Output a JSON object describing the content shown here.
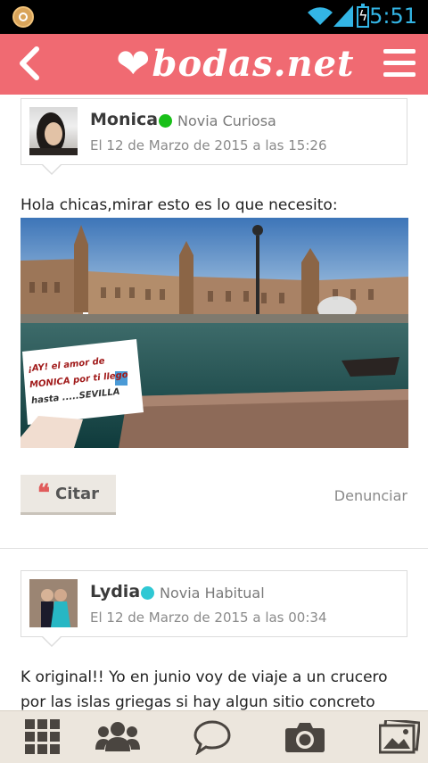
{
  "status_bar": {
    "time": "5:51"
  },
  "app_bar": {
    "brand": "bodas.net"
  },
  "posts": [
    {
      "author": "Monica",
      "online_color": "#19c019",
      "role": "Novia Curiosa",
      "date": "El 12 de Marzo de 2015 a las 15:26",
      "text": "Hola chicas,mirar esto es lo que necesito:",
      "sign_text": [
        "¡AY! el amor de",
        "MONICA por ti llego",
        "hasta .....SEVILLA"
      ],
      "cite_label": "Citar",
      "report_label": "Denunciar"
    },
    {
      "author": "Lydia",
      "online_color": "#2fc8d4",
      "role": "Novia Habitual",
      "date": "El 12 de Marzo de 2015 a las 00:34",
      "text": "K original!! Yo en junio voy de viaje a un crucero por las islas griegas si hay algun sitio concreto"
    }
  ],
  "bottom_nav": [
    "grid-icon",
    "community-icon",
    "chat-icon",
    "camera-icon",
    "photos-icon"
  ],
  "colors": {
    "brand": "#f06a72",
    "accent": "#33b5e5"
  }
}
